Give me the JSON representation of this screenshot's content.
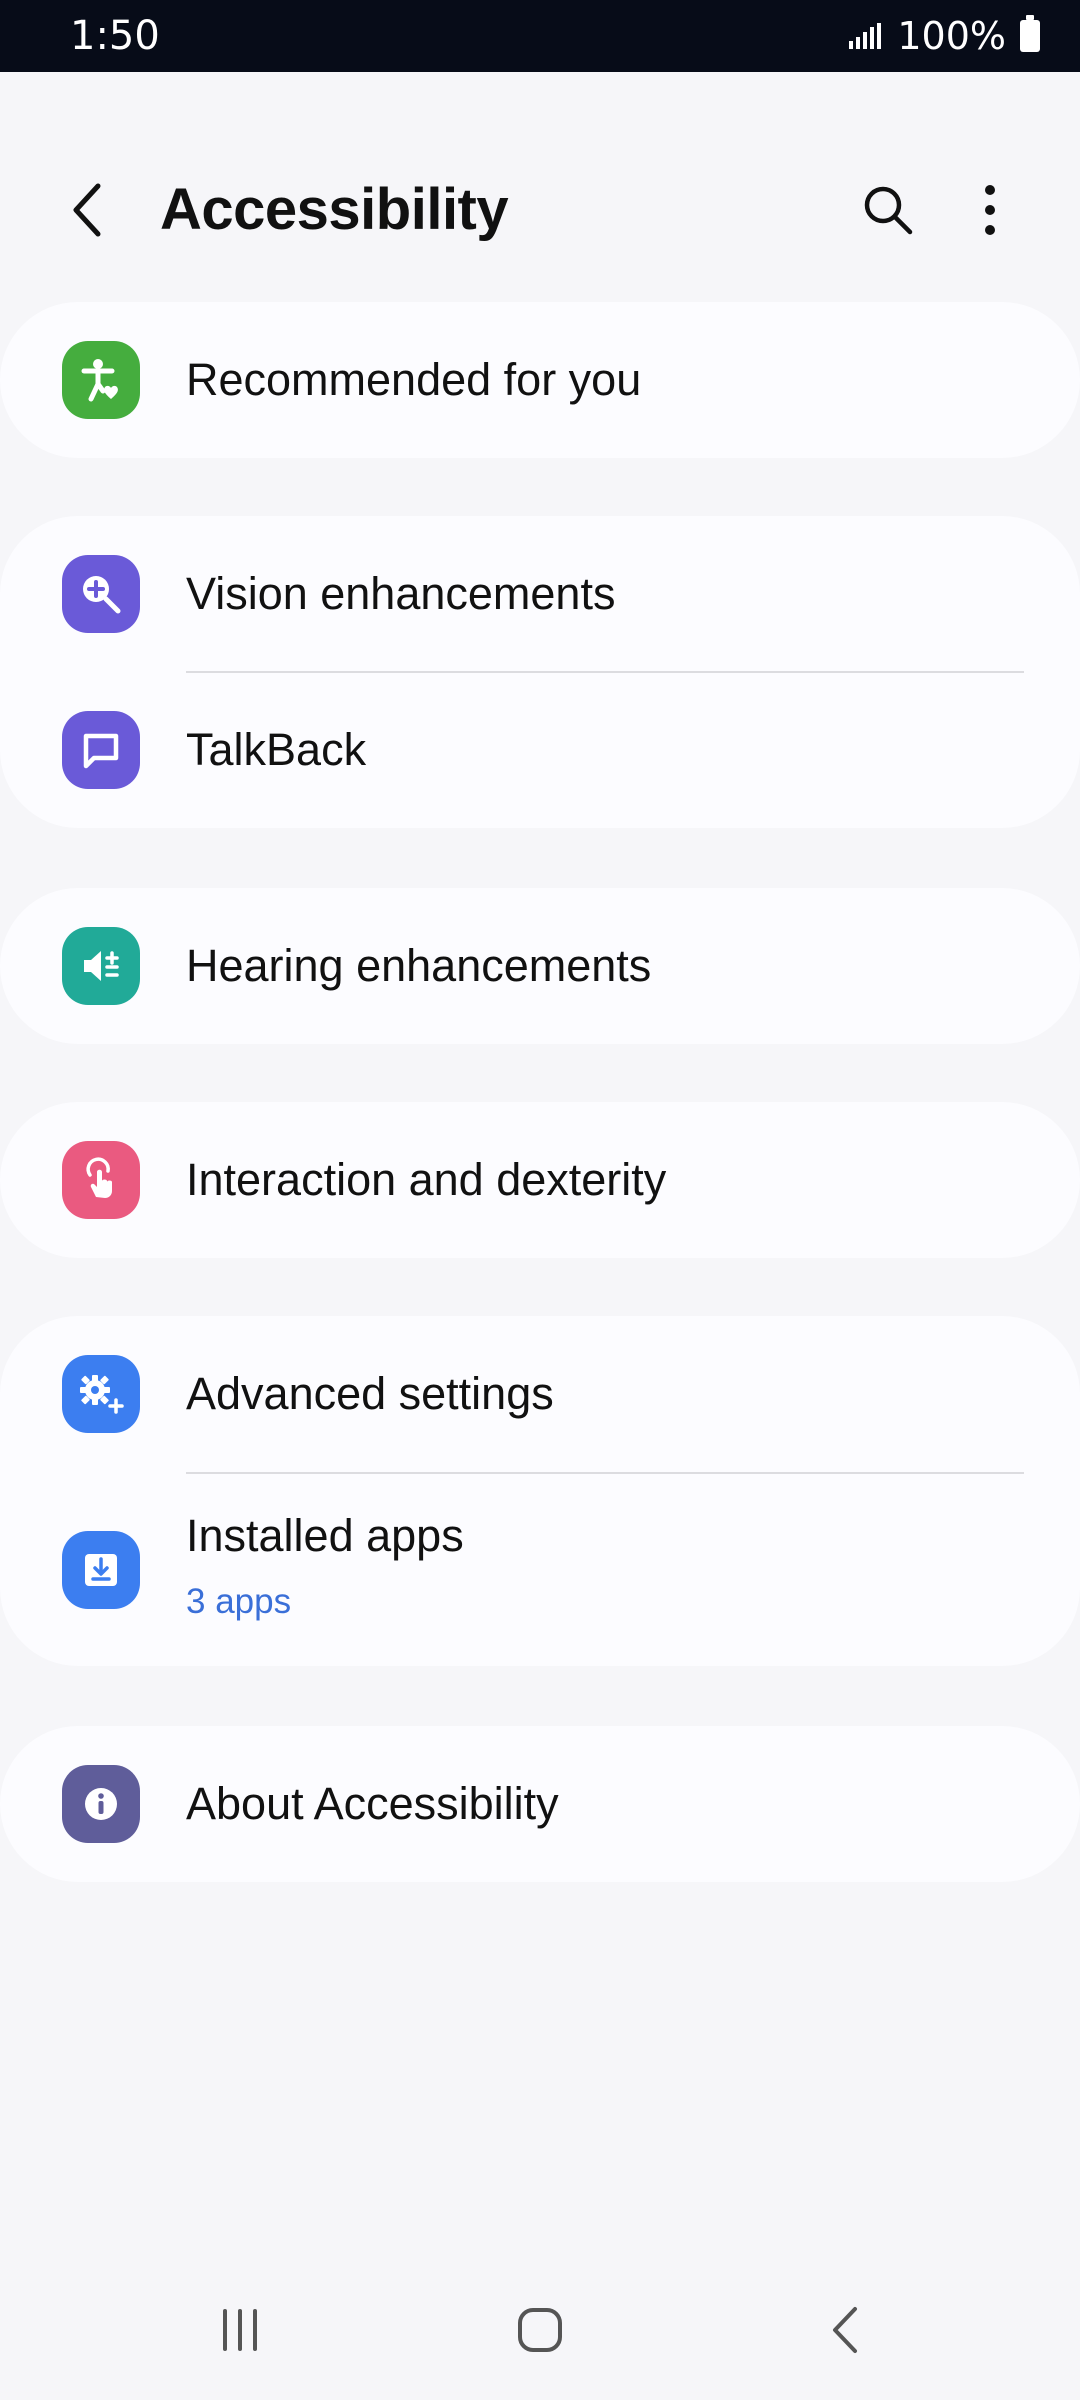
{
  "status": {
    "time": "1:50",
    "battery": "100%"
  },
  "header": {
    "title": "Accessibility",
    "back_icon": "back-arrow-icon",
    "search_icon": "search-icon",
    "more_icon": "more-vert-icon"
  },
  "items": {
    "recommended": {
      "label": "Recommended for you",
      "icon": "accessibility-person-icon",
      "color": "#45ad3e"
    },
    "vision": {
      "label": "Vision enhancements",
      "icon": "magnify-plus-icon",
      "color": "#6a5ad8"
    },
    "talkback": {
      "label": "TalkBack",
      "icon": "talkback-chat-icon",
      "color": "#6a5ad8"
    },
    "hearing": {
      "label": "Hearing enhancements",
      "icon": "volume-plus-minus-icon",
      "color": "#21aa98"
    },
    "interaction": {
      "label": "Interaction and dexterity",
      "icon": "touch-hand-icon",
      "color": "#ea5a80"
    },
    "advanced": {
      "label": "Advanced settings",
      "icon": "gear-plus-icon",
      "color": "#3c7ef0"
    },
    "installed": {
      "label": "Installed apps",
      "sub": "3 apps",
      "icon": "download-icon",
      "color": "#3c7ef0"
    },
    "about": {
      "label": "About Accessibility",
      "icon": "info-icon",
      "color": "#5f5d9a"
    }
  },
  "nav": {
    "recents_icon": "recents-icon",
    "home_icon": "home-icon",
    "back_icon": "nav-back-icon"
  }
}
